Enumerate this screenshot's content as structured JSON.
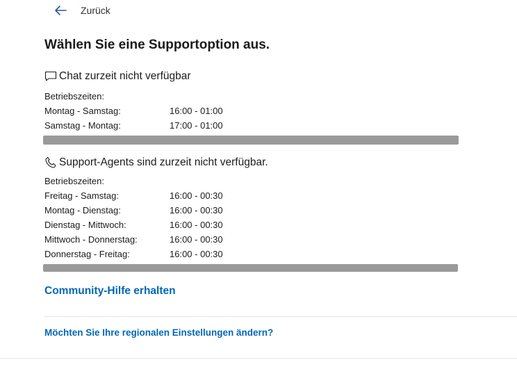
{
  "nav": {
    "back_label": "Zurück"
  },
  "page": {
    "title": "Wählen Sie eine Supportoption aus."
  },
  "chat": {
    "heading": "Chat zurzeit nicht verfügbar",
    "hours_label": "Betriebszeiten:",
    "hours": [
      {
        "day": "Montag - Samstag:",
        "time": "16:00 - 01:00"
      },
      {
        "day": "Samstag - Montag:",
        "time": "17:00 - 01:00"
      }
    ]
  },
  "phone": {
    "heading": "Support-Agents sind zurzeit nicht verfügbar.",
    "hours_label": "Betriebszeiten:",
    "hours": [
      {
        "day": "Freitag - Samstag:",
        "time": "16:00 - 00:30"
      },
      {
        "day": "Montag - Dienstag:",
        "time": "16:00 - 00:30"
      },
      {
        "day": "Dienstag - Mittwoch:",
        "time": "16:00 - 00:30"
      },
      {
        "day": "Mittwoch - Donnerstag:",
        "time": "16:00 - 00:30"
      },
      {
        "day": "Donnerstag - Freitag:",
        "time": "16:00 - 00:30"
      }
    ]
  },
  "links": {
    "community": "Community-Hilfe erhalten",
    "region": "Möchten Sie Ihre regionalen Einstellungen ändern?"
  },
  "icons": {
    "back": "arrow-left-icon",
    "chat": "chat-bubble-icon",
    "phone": "phone-icon"
  },
  "colors": {
    "link": "#0067b8",
    "text": "#1b1b1b",
    "redaction": "#9a9a9a"
  }
}
